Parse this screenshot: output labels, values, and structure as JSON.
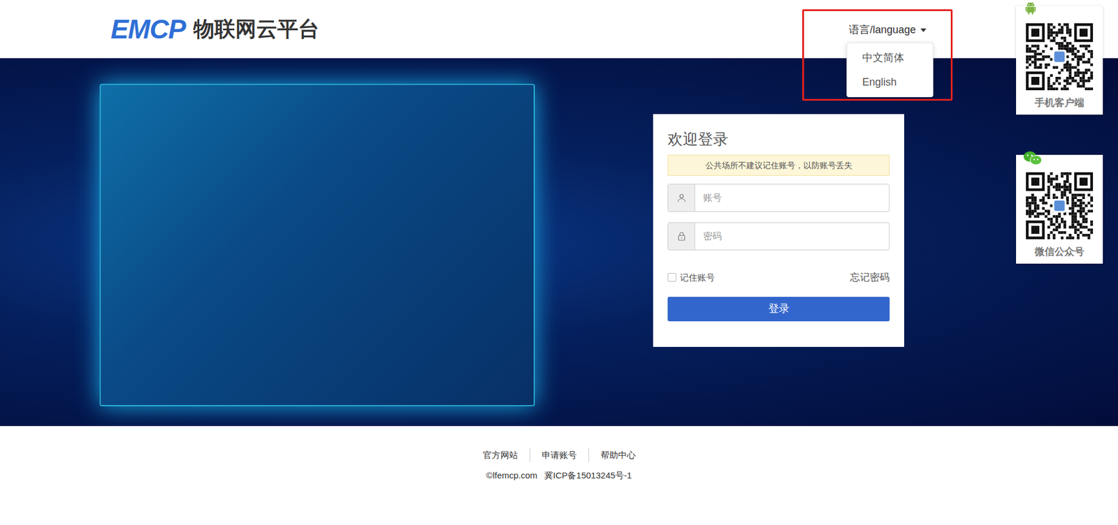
{
  "logo": {
    "mark": "EMCP",
    "title": "物联网云平台"
  },
  "language": {
    "label": "语言/language",
    "expanded": true,
    "highlighted": true,
    "options": [
      {
        "label": "中文简体",
        "selected": false
      },
      {
        "label": "English",
        "selected": false
      }
    ]
  },
  "qr_cards": [
    {
      "label": "手机客户端",
      "kind": "android"
    },
    {
      "label": "微信公众号",
      "kind": "wechat"
    }
  ],
  "login": {
    "title": "欢迎登录",
    "notice": "公共场所不建议记住账号，以防账号丢失",
    "fields": [
      {
        "placeholder": "账号",
        "kind": "user"
      },
      {
        "placeholder": "密码",
        "kind": "lock"
      }
    ],
    "remember": {
      "label": "记住账号",
      "checked": false
    },
    "forgot": "忘记密码",
    "submit": "登录"
  },
  "footer": {
    "links": [
      "官方网站",
      "申请账号",
      "帮助中心"
    ],
    "copyright": "©lfemcp.com",
    "icp": "冀ICP备15013245号-1"
  }
}
